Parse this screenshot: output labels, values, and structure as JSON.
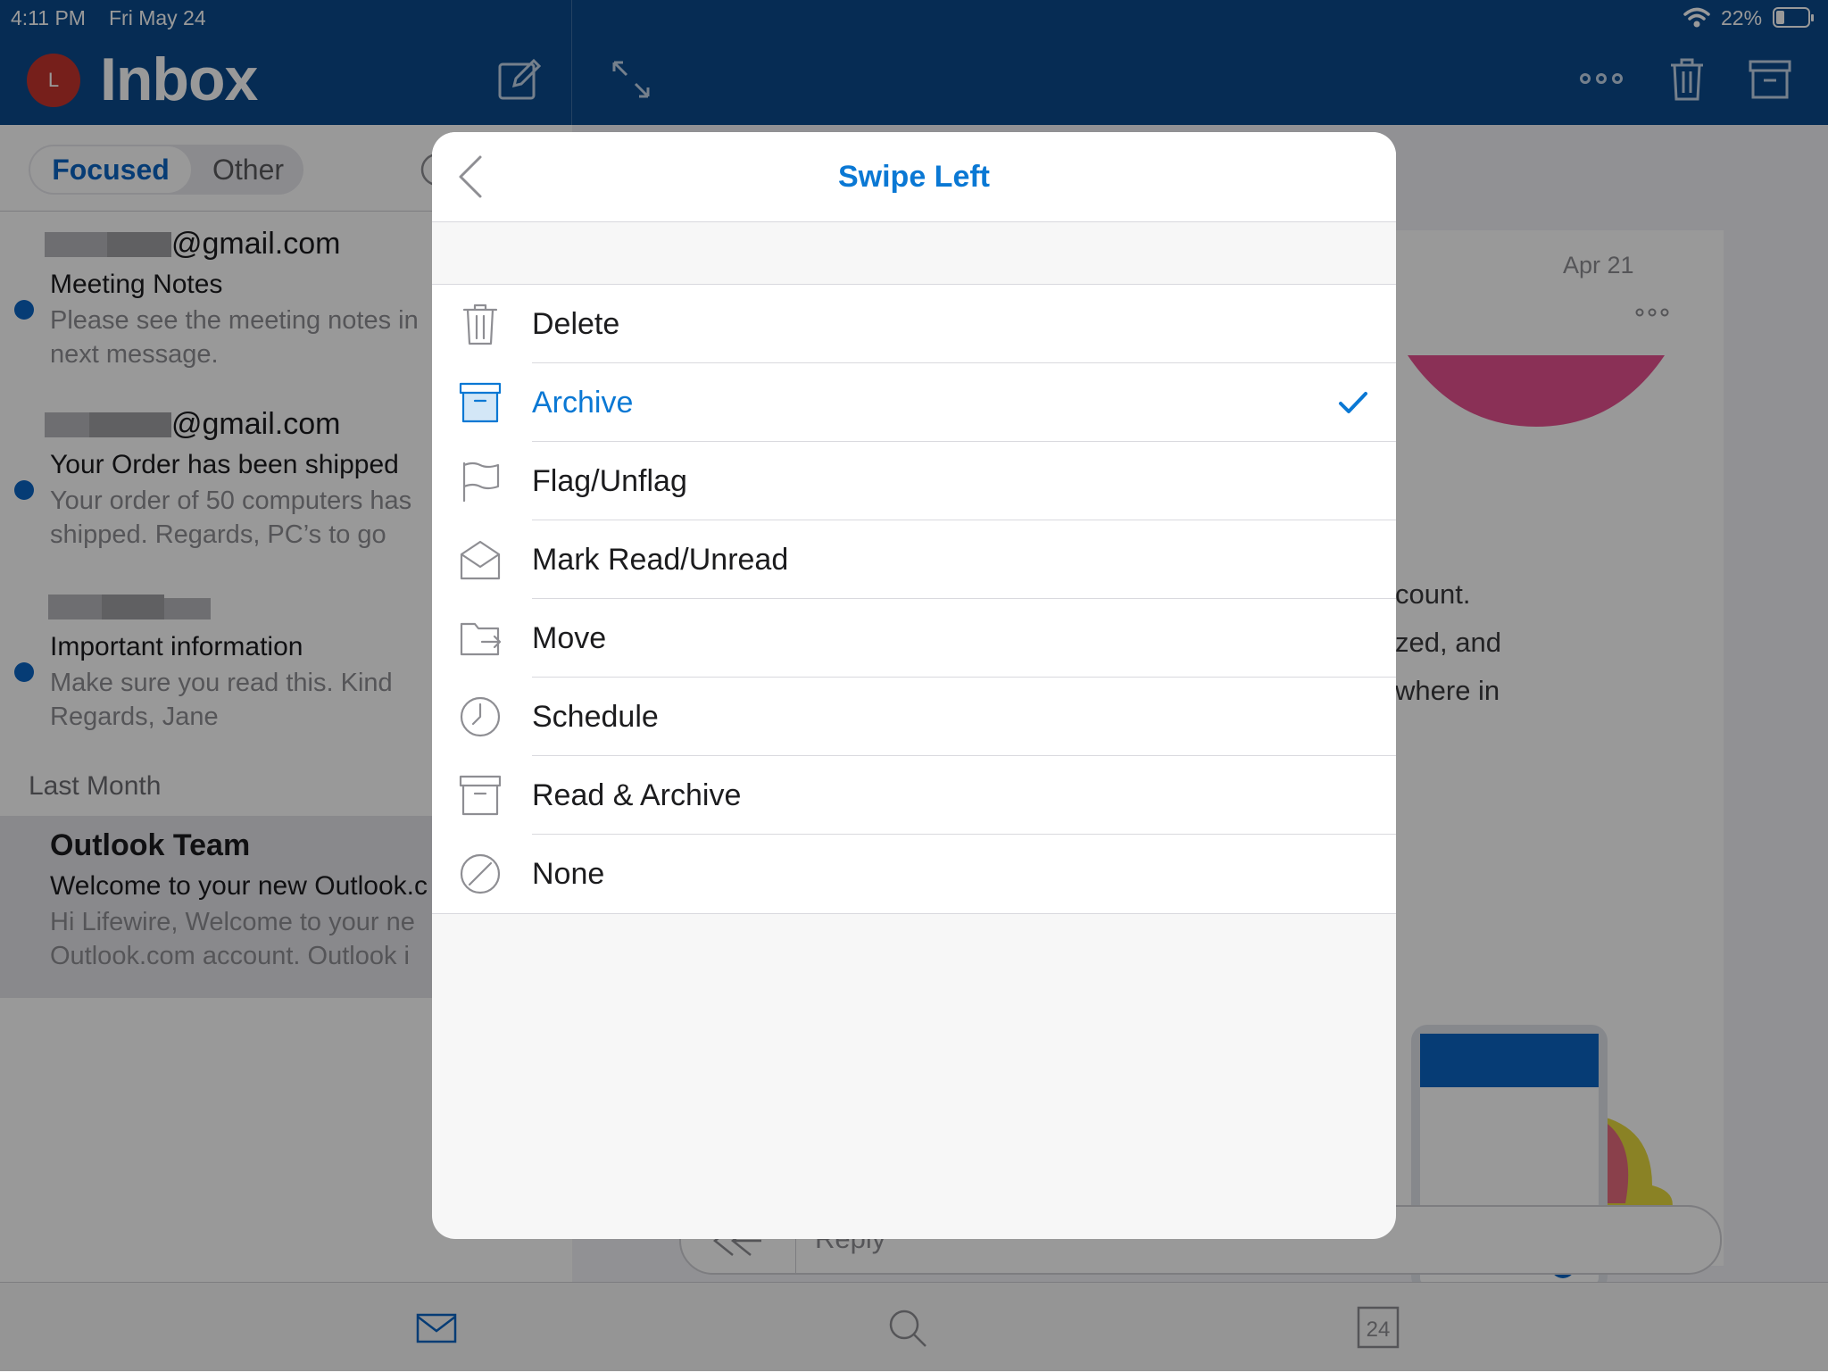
{
  "status_bar": {
    "time": "4:11 PM",
    "date": "Fri May 24",
    "battery": "22%"
  },
  "header": {
    "avatar_initial": "L",
    "title": "Inbox"
  },
  "tabs": {
    "focused": "Focused",
    "other": "Other"
  },
  "mail_list": [
    {
      "sender": "@gmail.com",
      "subject": "Meeting Notes",
      "preview_line1": "Please see the meeting notes in",
      "preview_line2": "next message.",
      "unread": true
    },
    {
      "sender": "@gmail.com",
      "subject": "Your Order has been shipped",
      "preview_line1": "Your order of 50 computers has",
      "preview_line2": "shipped. Regards, PC’s to go",
      "unread": true
    },
    {
      "sender": "",
      "subject": "Important information",
      "preview_line1": "Make sure you read this. Kind",
      "preview_line2": "Regards, Jane",
      "unread": true
    }
  ],
  "section_last_month": "Last Month",
  "outlook_mail": {
    "sender": "Outlook Team",
    "subject": "Welcome to your new Outlook.c",
    "preview_line1": "Hi Lifewire, Welcome to your ne",
    "preview_line2": "Outlook.com account. Outlook i"
  },
  "reading_pane": {
    "date": "Apr 21",
    "body_line1": "count.",
    "body_line2": "zed, and",
    "body_line3": "where in",
    "reply": "Reply"
  },
  "tabbar": {
    "calendar_day": "24"
  },
  "modal": {
    "title": "Swipe Left",
    "options": [
      {
        "label": "Delete",
        "icon": "trash-icon",
        "selected": false
      },
      {
        "label": "Archive",
        "icon": "archive-icon",
        "selected": true
      },
      {
        "label": "Flag/Unflag",
        "icon": "flag-icon",
        "selected": false
      },
      {
        "label": "Mark Read/Unread",
        "icon": "envelope-open-icon",
        "selected": false
      },
      {
        "label": "Move",
        "icon": "folder-move-icon",
        "selected": false
      },
      {
        "label": "Schedule",
        "icon": "clock-icon",
        "selected": false
      },
      {
        "label": "Read & Archive",
        "icon": "read-archive-icon",
        "selected": false
      },
      {
        "label": "None",
        "icon": "none-icon",
        "selected": false
      }
    ]
  },
  "colors": {
    "header_blue": "#0a4a8c",
    "accent_blue": "#0a78d4",
    "unread_dot": "#0a64c4",
    "avatar_red": "#c5352e"
  }
}
